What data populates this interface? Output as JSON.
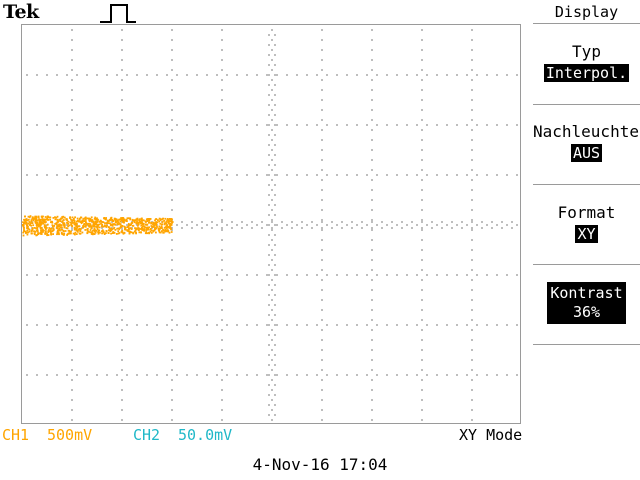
{
  "header": {
    "brand": "Tek",
    "trigger_icon": "pulse-edge-icon"
  },
  "status_bar": {
    "ch1_label": "CH1",
    "ch1_scale": "500mV",
    "ch2_label": "CH2",
    "ch2_scale": "50.0mV",
    "mode": "XY Mode",
    "datetime": "4-Nov-16 17:04"
  },
  "colors": {
    "ch1": "#FFA500",
    "ch2": "#20B8C8",
    "graticule": "#9a9a9a"
  },
  "menu": {
    "title": "Display",
    "items": [
      {
        "label": "Typ",
        "value": "Interpol."
      },
      {
        "label": "Nachleuchten",
        "value": "AUS"
      },
      {
        "label": "Format",
        "value": "XY"
      },
      {
        "label": "Kontrast",
        "value": "36%"
      }
    ]
  }
}
